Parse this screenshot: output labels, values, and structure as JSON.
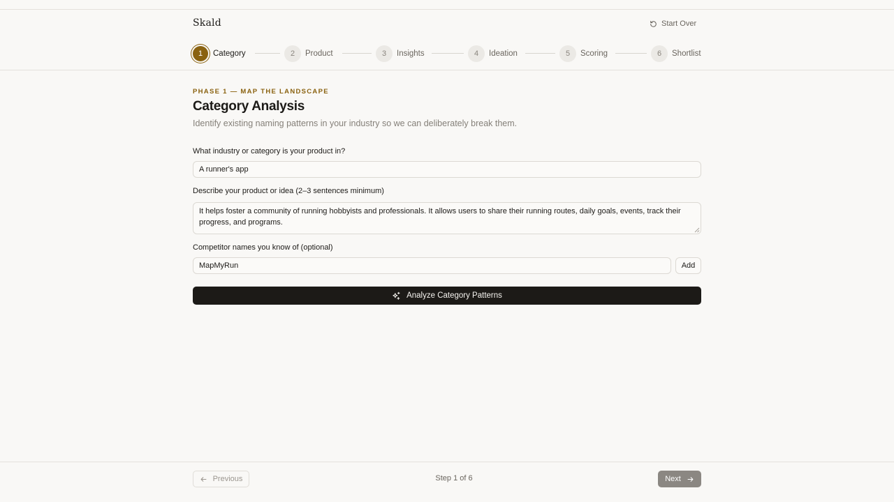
{
  "app": {
    "name": "Skald",
    "start_over_label": "Start Over"
  },
  "steps": [
    {
      "number": "1",
      "label": "Category",
      "active": true
    },
    {
      "number": "2",
      "label": "Product",
      "active": false
    },
    {
      "number": "3",
      "label": "Insights",
      "active": false
    },
    {
      "number": "4",
      "label": "Ideation",
      "active": false
    },
    {
      "number": "5",
      "label": "Scoring",
      "active": false
    },
    {
      "number": "6",
      "label": "Shortlist",
      "active": false
    }
  ],
  "main": {
    "phase": "PHASE 1 — MAP THE LANDSCAPE",
    "title": "Category Analysis",
    "subtitle": "Identify existing naming patterns in your industry so we can deliberately break them."
  },
  "form": {
    "industry_label": "What industry or category is your product in?",
    "industry_value": "A runner's app",
    "description_label": "Describe your product or idea (2–3 sentences minimum)",
    "description_value": "It helps foster a community of running hobbyists and professionals. It allows users to share their running routes, daily goals, events, track their progress, and programs.",
    "competitors_label": "Competitor names you know of (optional)",
    "competitor_value": "MapMyRun",
    "add_label": "Add",
    "analyze_label": "Analyze Category Patterns"
  },
  "footer": {
    "previous_label": "Previous",
    "step_count": "Step 1 of 6",
    "next_label": "Next"
  },
  "colors": {
    "accent": "#8a6210",
    "primary_button": "#1c1a17",
    "background": "#f9f8f6"
  }
}
